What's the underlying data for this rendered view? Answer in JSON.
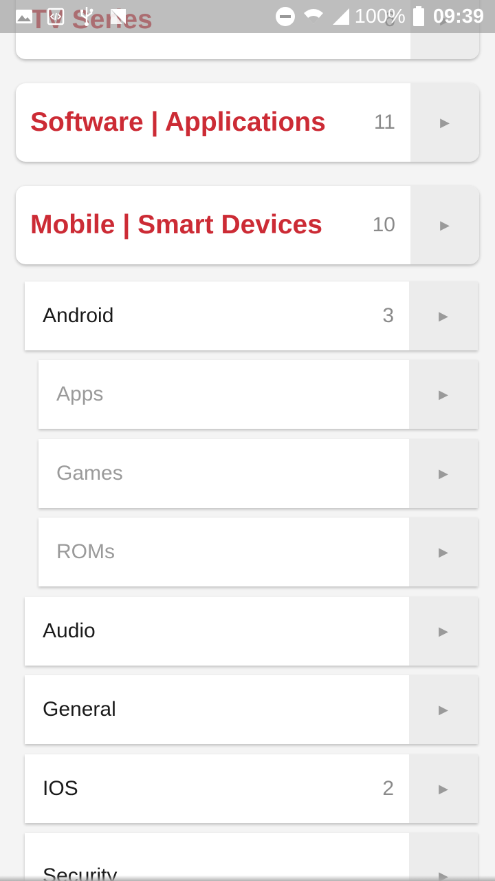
{
  "status_bar": {
    "battery": "100%",
    "time": "09:39",
    "icons_left": [
      "image-icon",
      "code-icon",
      "usb-icon",
      "no-sim-icon"
    ],
    "icons_right": [
      "do-not-disturb-icon",
      "wifi-icon",
      "signal-icon",
      "battery-icon"
    ]
  },
  "categories": [
    {
      "title": "TV Series",
      "count": "6"
    },
    {
      "title": "Software | Applications",
      "count": "11"
    },
    {
      "title": "Mobile | Smart Devices",
      "count": "10"
    }
  ],
  "subcategories": [
    {
      "label": "Android",
      "count": "3",
      "level": 1
    },
    {
      "label": "Apps",
      "count": "",
      "level": 2
    },
    {
      "label": "Games",
      "count": "",
      "level": 2
    },
    {
      "label": "ROMs",
      "count": "",
      "level": 2
    },
    {
      "label": "Audio",
      "count": "",
      "level": 1
    },
    {
      "label": "General",
      "count": "",
      "level": 1
    },
    {
      "label": "IOS",
      "count": "2",
      "level": 1
    },
    {
      "label": "Security",
      "count": "",
      "level": 1
    }
  ],
  "arrow_glyph": "▶",
  "colors": {
    "accent": "#cc2b35",
    "arrow_bg": "#ececec"
  }
}
